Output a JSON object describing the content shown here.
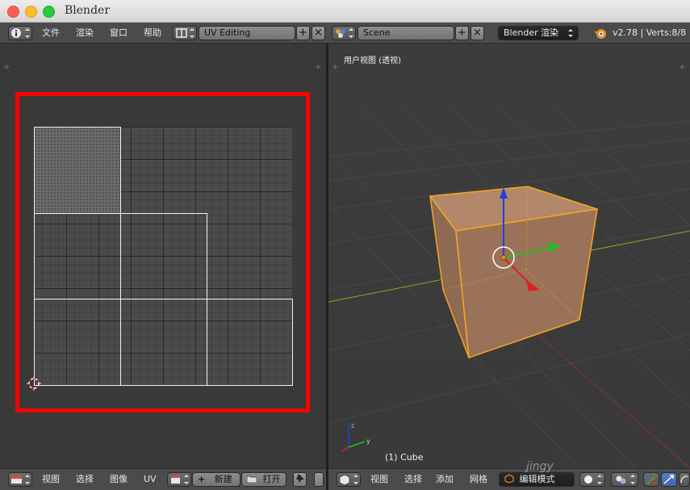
{
  "window": {
    "title": "Blender"
  },
  "topbar": {
    "menus": [
      "文件",
      "渲染",
      "窗口",
      "帮助"
    ],
    "layout_name": "UV Editing",
    "scene_name": "Scene",
    "render_engine": "Blender 渲染",
    "version_stats": "v2.78 | Verts:8/8 |"
  },
  "viewport": {
    "view_label": "用户视图 (透视)",
    "object_label": "(1) Cube"
  },
  "uv_bottombar": {
    "menus": [
      "视图",
      "选择",
      "图像",
      "UV"
    ],
    "new_label": "新建",
    "open_label": "打开"
  },
  "v3d_bottombar": {
    "menus": [
      "视图",
      "选择",
      "添加",
      "网格"
    ],
    "mode": "编辑模式"
  },
  "colors": {
    "highlight_box": "#ff0000",
    "selected_edges": "#f5a623",
    "cube_face": "#a67c5c",
    "axis_x": "#e02020",
    "axis_y": "#20c020",
    "axis_z": "#2040e0"
  },
  "icons": [
    "info-icon",
    "layout-icon",
    "scene-icon",
    "blender-logo-icon",
    "image-editor-icon",
    "image-browse-icon",
    "pin-icon",
    "view3d-icon",
    "viewport-shading-icon",
    "pivot-icon",
    "manipulator-icon"
  ]
}
